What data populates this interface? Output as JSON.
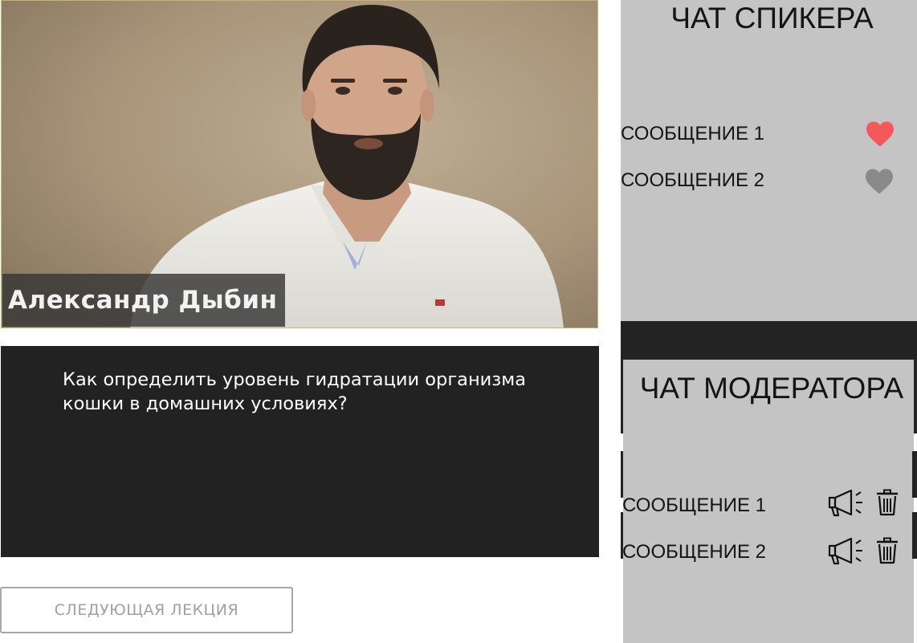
{
  "video": {
    "speaker_name": "Александр Дыбин"
  },
  "question": {
    "text": "Как определить уровень гидратации организма кошки в домашних условиях?"
  },
  "next_button": {
    "label": "СЛЕДУЮЩАЯ ЛЕКЦИЯ"
  },
  "speaker_chat": {
    "title": "ЧАТ СПИКЕРА",
    "messages": [
      {
        "text": "СООБЩЕНИЕ 1",
        "icon": "heart-icon",
        "liked": true,
        "color": "#f4585a"
      },
      {
        "text": "СООБЩЕНИЕ 2",
        "icon": "heart-icon",
        "liked": false,
        "color": "#8a8a8a"
      }
    ]
  },
  "moderator_chat": {
    "title": "ЧАТ МОДЕРАТОРА",
    "messages": [
      {
        "text": "СООБЩЕНИЕ 1",
        "actions": [
          "megaphone-icon",
          "trash-icon"
        ]
      },
      {
        "text": "СООБЩЕНИЕ 2",
        "actions": [
          "megaphone-icon",
          "trash-icon"
        ]
      }
    ]
  },
  "colors": {
    "dark_panel": "#222222",
    "chat_background": "#c4c4c4",
    "heart_liked": "#f4585a",
    "heart_default": "#8a8a8a"
  }
}
